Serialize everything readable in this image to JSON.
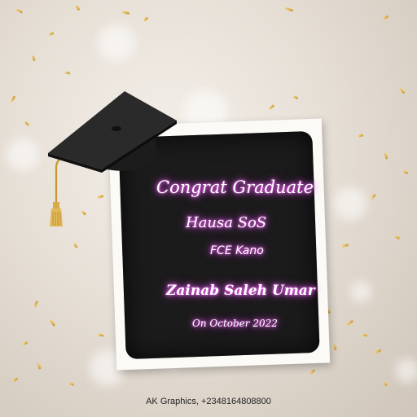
{
  "card": {
    "heading": "Congrat Graduate",
    "department": "Hausa SoS",
    "institution": "FCE Kano",
    "graduate_name": "Zainab Saleh Umar",
    "date_line": "On October 2022"
  },
  "footer": {
    "credit": "AK Graphics,  +2348164808800"
  },
  "colors": {
    "board": "#1b1b1b",
    "frame": "#fbfaf6",
    "text_glow": "#e85cf0",
    "confetti_gold": "#d9a84a"
  },
  "icons": [
    "graduation-cap-icon"
  ]
}
